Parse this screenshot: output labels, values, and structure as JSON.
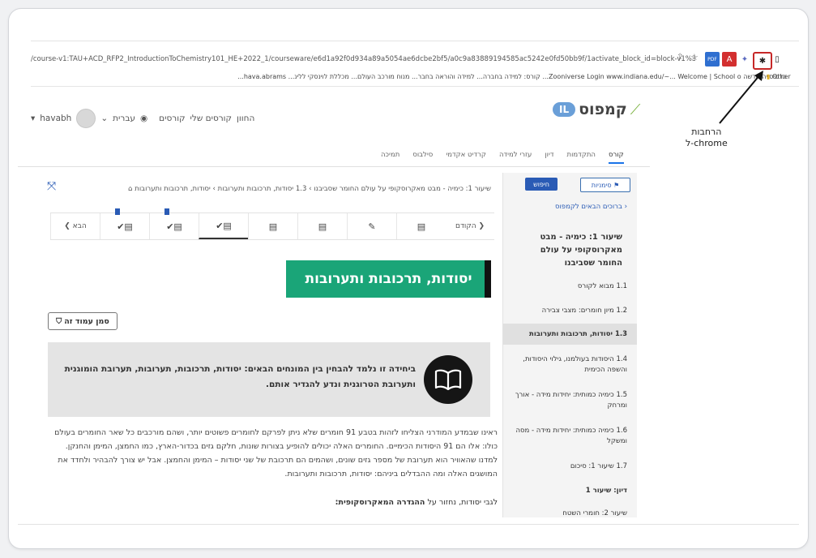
{
  "browser": {
    "url": "/course-v1:TAU+ACD_RFP2_IntroductionToChemistry101_HE+2022_1/courseware/e6d1a92f0d934a89a5054ae6dcbe2bf5/a0c9a83889194585ac5242e0fd50bb9f/1activate_block_id=block-v1%3ATAU%28...",
    "bookmarks": "כרטיסייה חדשה  Zooniverse Login  www.indiana.edu/~...  Welcome | School o...  קורס: למידה בחברה...  למידה והוראה בחבר...  מנוח מורכב העולם...  מכללת לוינסקי ללינ...  hava.abrams...",
    "bookmark_other": "Other",
    "extensions": [
      {
        "name": "pdf-extension",
        "glyph": "PDF",
        "color": "#2f6fd0"
      },
      {
        "name": "acrobat-extension",
        "glyph": "A",
        "color": "#d32f2f"
      },
      {
        "name": "ext-icon",
        "glyph": "✦",
        "color": "#5c6bc0"
      },
      {
        "name": "extensions-puzzle",
        "glyph": "✱",
        "color": "#222"
      }
    ],
    "annotation": [
      "הרחבות",
      "chrome-ל"
    ]
  },
  "header": {
    "user": "havabh",
    "language": "עברית",
    "links": [
      "קורסים",
      "קורסים שלי",
      "החוון"
    ],
    "logo_badge": "IL",
    "logo_text": "קמפוס"
  },
  "course_tabs": [
    "קורס",
    "התקדמות",
    "דיון",
    "עזרי למידה",
    "קרדיט אקדמי",
    "סילבוס",
    "תמיכה"
  ],
  "breadcrumb": "שיעור 1: כימיה - מבט מאקרוסקופי על עולם החומר שסביבנו  ›  1.3 יסודות, תרכובות ותערובות  ›  יסודות, תרכובות ותערובות",
  "unit_nav": {
    "prev": "הקודם",
    "next": "הבא",
    "units": [
      "▤",
      "✎",
      "▤",
      "▤",
      "✔▤",
      "✔▤",
      "✔▤"
    ]
  },
  "sidebar": {
    "bookmarks_btn": "סימניות",
    "search_btn": "חיפוש",
    "welcome": "ברוכים הבאים לקמפוס",
    "lesson": "שיעור 1: כימיה - מבט מאקרוסקופי על עולם החומר שסביבנו",
    "items": [
      "1.1 מבוא לקורס",
      "1.2 מיון חומרים: מצבי צבירה",
      "1.3 יסודות, תרכובות ותערובות",
      "1.4 היסודות בעולמנו, גילוי היסודות, והשפה הכימית",
      "1.5 כימיה כמותית: יחידות מידה - אורך ומרחק",
      "1.6 כימיה כמותית: יחידות מידה - מסה ומשקל",
      "1.7 שיעור 1: סיכום",
      "דיון: שיעור 1",
      "שיעור 2: חומרי השטח"
    ]
  },
  "content": {
    "headline": "יסודות, תרכובות ותערובות",
    "bookmark_btn": "סמן עמוד זה",
    "info": "ביחידה זו נלמד להבחין בין המונחים הבאים: יסודות, תרכובות, תערובות, תערובת הומוגנית ותערובת הטרוגנית ונדע להגדיר אותם.",
    "body": "ראינו שבמדע המודרני הצליחו לזהות בטבע 91 חומרים שלא ניתן לפרקם לחומרים פשוטים יותר, ושהם מורכבים כל שאר החומרים בעולם כולו: אלו הם 91 היסודות הכימיים. החומרים האלה יכולים להופיע בצורות שונות, חלקם גזים בכדור-הארץ, כמו החמצן, המימן והחנקן. למדנו שהאוויר הוא תערובת של מספר גזים שונים, ושהמים הם תרכובת של שני יסודות – המימן והחמצן. אבל יש צורך להבהיר ולחדד את המושגים האלה ומה ההבדלים ביניהם: יסודות, תרכובות ותערובות.",
    "body2_prefix": "לגבי יסודות, נחזור על",
    "body2_bold": "ההגדרה המאקרוסקופית:"
  }
}
